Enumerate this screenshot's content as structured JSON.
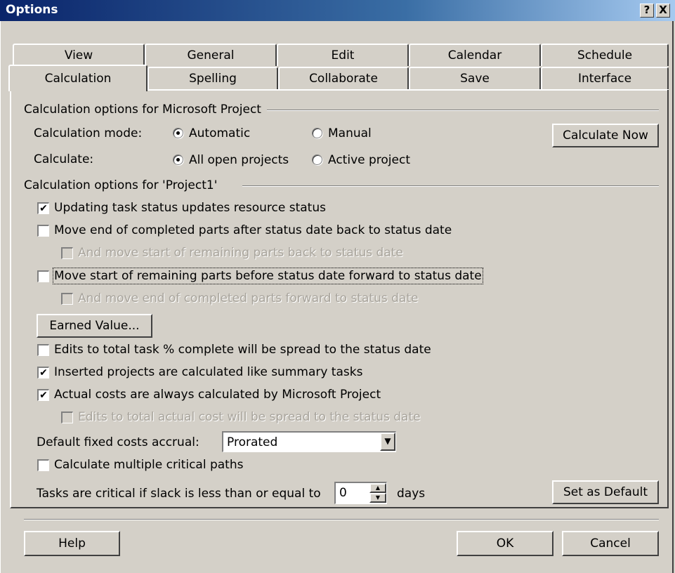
{
  "window": {
    "title": "Options",
    "help_glyph": "?",
    "close_glyph": "X"
  },
  "tabs": {
    "row1": [
      "View",
      "General",
      "Edit",
      "Calendar",
      "Schedule"
    ],
    "row2": [
      "Calculation",
      "Spelling",
      "Collaborate",
      "Save",
      "Interface"
    ],
    "active": "Calculation"
  },
  "section1": {
    "label": "Calculation options for Microsoft Project",
    "mode_label": "Calculation mode:",
    "mode_options": [
      "Automatic",
      "Manual"
    ],
    "mode_selected": "Automatic",
    "calc_label": "Calculate:",
    "calc_options": [
      "All open projects",
      "Active project"
    ],
    "calc_selected": "All open projects",
    "calculate_now": "Calculate Now"
  },
  "section2": {
    "label": "Calculation options for 'Project1'",
    "checks": [
      {
        "label": "Updating task status updates resource status",
        "checked": true,
        "enabled": true
      },
      {
        "label": "Move end of completed parts after status date back to status date",
        "checked": false,
        "enabled": true
      },
      {
        "label": "And move start of remaining parts back to status date",
        "checked": false,
        "enabled": false
      },
      {
        "label": "Move start of remaining parts before status date forward to status date",
        "checked": false,
        "enabled": true
      },
      {
        "label": "And move end of completed parts forward to status date",
        "checked": false,
        "enabled": false
      }
    ],
    "earned_value": "Earned Value...",
    "checks2": [
      {
        "label": "Edits to total task % complete will be spread to the status date",
        "checked": false,
        "enabled": true
      },
      {
        "label": "Inserted projects are calculated like summary tasks",
        "checked": true,
        "enabled": true
      },
      {
        "label": "Actual costs are always calculated by Microsoft Project",
        "checked": true,
        "enabled": true
      },
      {
        "label": "Edits to total actual cost will be spread to the status date",
        "checked": false,
        "enabled": false
      }
    ],
    "accrual_label": "Default fixed costs accrual:",
    "accrual_value": "Prorated",
    "multi_paths": {
      "label": "Calculate multiple critical paths",
      "checked": false
    },
    "slack_label": "Tasks are critical if slack is less than or equal to",
    "slack_value": "0",
    "slack_unit": "days",
    "set_default": "Set as Default"
  },
  "footer": {
    "help": "Help",
    "ok": "OK",
    "cancel": "Cancel"
  },
  "icons": {
    "check": "✔",
    "dropdown": "▼",
    "spin_up": "▲",
    "spin_down": "▼"
  }
}
